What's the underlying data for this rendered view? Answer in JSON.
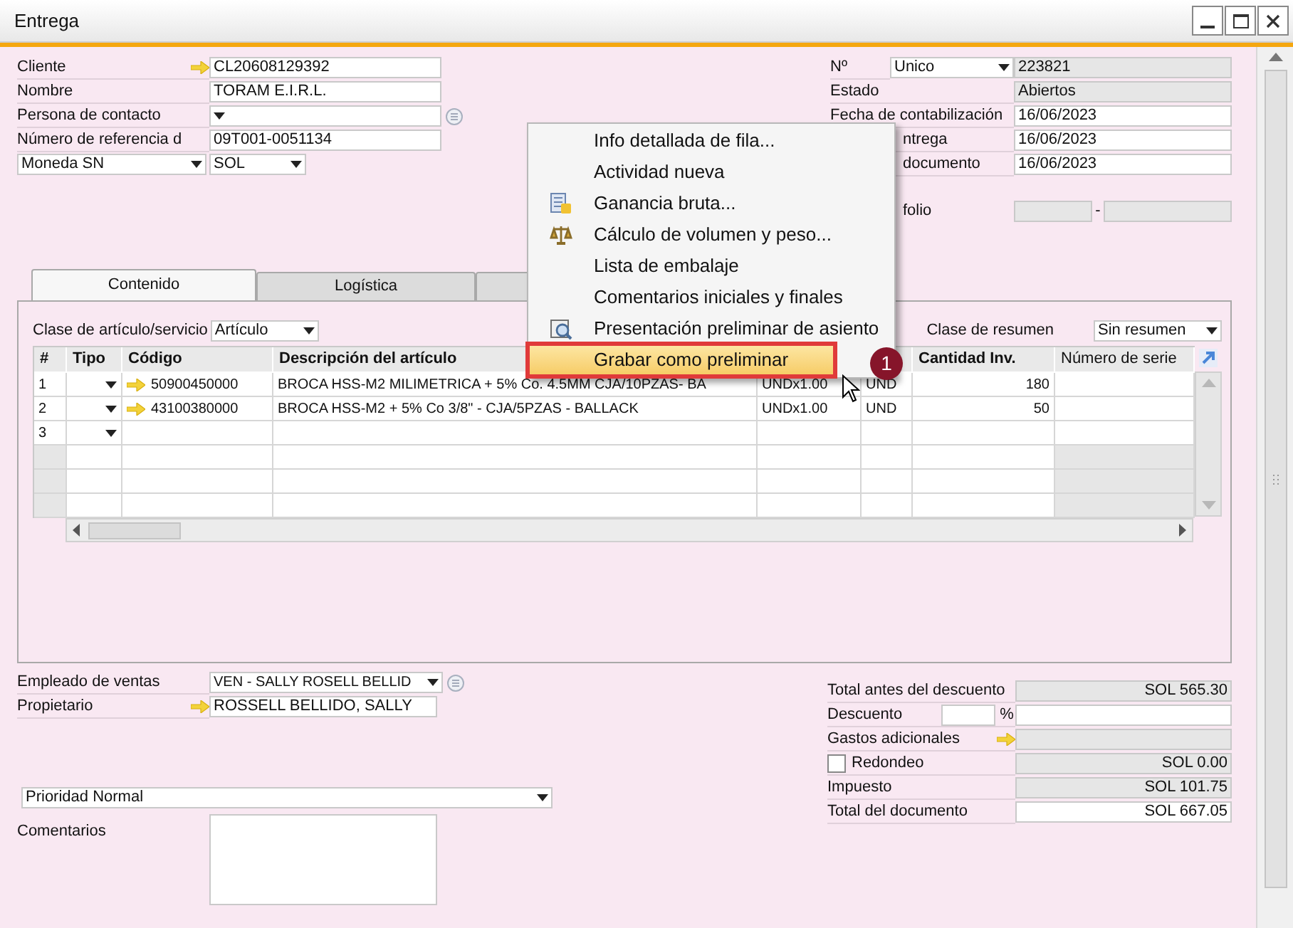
{
  "window": {
    "title": "Entrega"
  },
  "header_left": [
    {
      "kind": "text",
      "label": "Cliente",
      "value": "CL20608129392",
      "link": true
    },
    {
      "kind": "text",
      "label": "Nombre",
      "value": "TORAM E.I.R.L.",
      "link": false
    },
    {
      "kind": "select",
      "label": "Persona de contacto"
    },
    {
      "kind": "text",
      "label": "Número de referencia d",
      "value": "09T001-0051134",
      "link": false
    },
    {
      "kind": "currency",
      "label": "Moneda SN",
      "value": "SOL"
    }
  ],
  "header_right": [
    {
      "kind": "series",
      "label": "Nº",
      "series": "Unico",
      "value": "223821",
      "readonly": true,
      "clipped": false
    },
    {
      "kind": "text",
      "label": "Estado",
      "value": "Abiertos",
      "readonly": true,
      "clipped": false
    },
    {
      "kind": "text",
      "label": "Fecha de contabilización",
      "value": "16/06/2023",
      "readonly": false,
      "clipped": false
    },
    {
      "kind": "text",
      "label": "ntrega",
      "value": "16/06/2023",
      "readonly": false,
      "clipped": true
    },
    {
      "kind": "text",
      "label": "documento",
      "value": "16/06/2023",
      "readonly": false,
      "clipped": true
    },
    {
      "kind": "range",
      "label": "folio",
      "separator": "-",
      "readonly": true,
      "clipped": true
    }
  ],
  "tabs": [
    {
      "label": "Contenido",
      "selected": true
    },
    {
      "label": "Logística",
      "selected": false
    },
    {
      "selected": false
    }
  ],
  "item_class": {
    "label": "Clase de artículo/servicio",
    "value": "Artículo"
  },
  "summary_class": {
    "label": "Clase de resumen",
    "value": "Sin resumen"
  },
  "table": {
    "columns": [
      "#",
      "Tipo",
      "Código",
      "Descripción del artículo",
      null,
      null,
      "Cantidad Inv.",
      "Número de serie"
    ],
    "rows": [
      {
        "num": "1",
        "code": "50900450000",
        "description": "BROCA HSS-M2 MILIMETRICA + 5% Co. 4.5MM  CJA/10PZAS- BA",
        "column_5": "UNDx1.00",
        "column_6": "UND",
        "quantity": "180"
      },
      {
        "num": "2",
        "code": "43100380000",
        "description": "BROCA HSS-M2 + 5% Co 3/8\" - CJA/5PZAS - BALLACK",
        "column_5": "UNDx1.00",
        "column_6": "UND",
        "quantity": "50"
      },
      {
        "num": "3"
      }
    ]
  },
  "sales_employee": {
    "label": "Empleado de ventas",
    "value": "VEN - SALLY ROSELL BELLID"
  },
  "owner": {
    "label": "Propietario",
    "value": "ROSSELL BELLIDO, SALLY"
  },
  "priority": {
    "value": "Prioridad Normal"
  },
  "comments": {
    "label": "Comentarios"
  },
  "totals": [
    {
      "kind": "readonly",
      "label": "Total antes del descuento",
      "value": "SOL 565.30"
    },
    {
      "kind": "discount",
      "label": "Descuento",
      "percent": "%"
    },
    {
      "kind": "link",
      "label": "Gastos adicionales"
    },
    {
      "kind": "checkbox",
      "label": "Redondeo",
      "checked": false,
      "value": "SOL 0.00"
    },
    {
      "kind": "readonly",
      "label": "Impuesto",
      "value": "SOL 101.75"
    },
    {
      "kind": "editable",
      "label": "Total del documento",
      "value": "SOL 667.05"
    }
  ],
  "context_menu": {
    "items": [
      {
        "label": "Info detallada de fila...",
        "kind": "plain",
        "selected": false
      },
      {
        "label": "Actividad nueva",
        "kind": "plain",
        "selected": false
      },
      {
        "label": "Ganancia bruta...",
        "kind": "ledger",
        "selected": false
      },
      {
        "label": "Cálculo de volumen y peso...",
        "kind": "scale",
        "selected": false
      },
      {
        "label": "Lista de embalaje",
        "kind": "plain",
        "selected": false
      },
      {
        "label": "Comentarios iniciales y finales",
        "kind": "plain",
        "selected": false
      },
      {
        "label": "Presentación preliminar de asiento",
        "kind": "preview",
        "selected": false
      },
      {
        "label": "Grabar como preliminar",
        "kind": "plain",
        "selected": true
      }
    ]
  },
  "step_badge": {
    "text": "1"
  }
}
